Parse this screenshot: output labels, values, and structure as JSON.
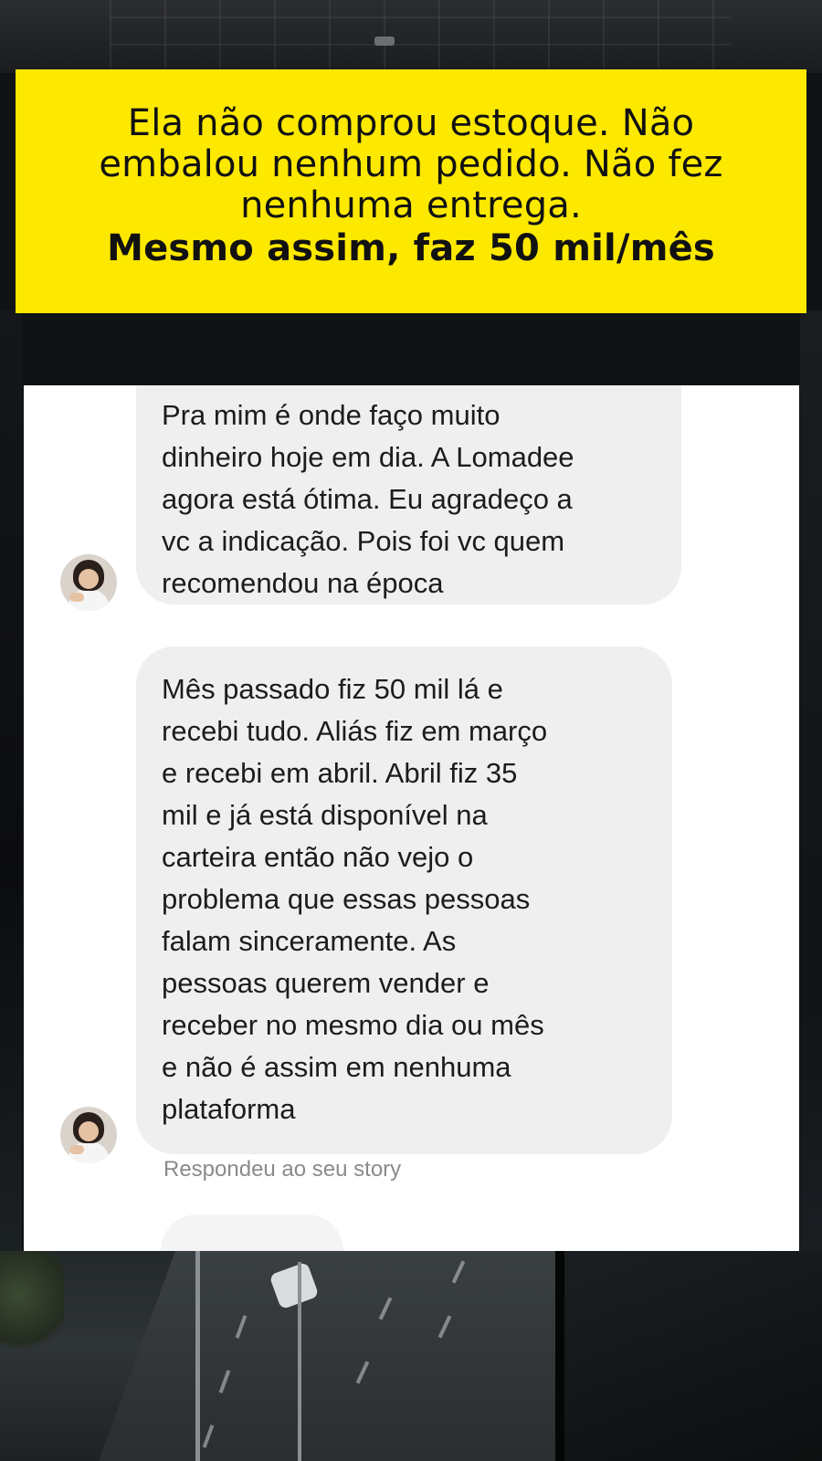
{
  "banner": {
    "line1": "Ela não comprou estoque. Não",
    "line2": "embalou nenhum pedido. Não fez",
    "line3": "nenhuma entrega.",
    "headline": "Mesmo assim, faz 50 mil/mês",
    "background_color": "#fde800"
  },
  "chat": {
    "messages": [
      {
        "lines": [
          "Pra mim é onde faço muito",
          "dinheiro hoje em dia. A Lomadee",
          "agora está ótima. Eu agradeço a",
          "vc a indicação. Pois foi vc quem",
          "recomendou na época"
        ],
        "avatar_icon": "user-avatar-photo"
      },
      {
        "lines": [
          "Mês passado fiz 50 mil lá e",
          "recebi tudo. Aliás fiz em março",
          "e recebi em abril. Abril fiz 35",
          "mil e já está disponível na",
          "carteira então não vejo o",
          "problema que essas pessoas",
          "falam sinceramente. As",
          "pessoas querem vender e",
          "receber no mesmo dia ou mês",
          "e não é assim em nenhuma",
          "plataforma"
        ],
        "avatar_icon": "user-avatar-photo"
      }
    ],
    "reply_note": "Respondeu ao seu story",
    "bubble_color": "#efefef"
  }
}
